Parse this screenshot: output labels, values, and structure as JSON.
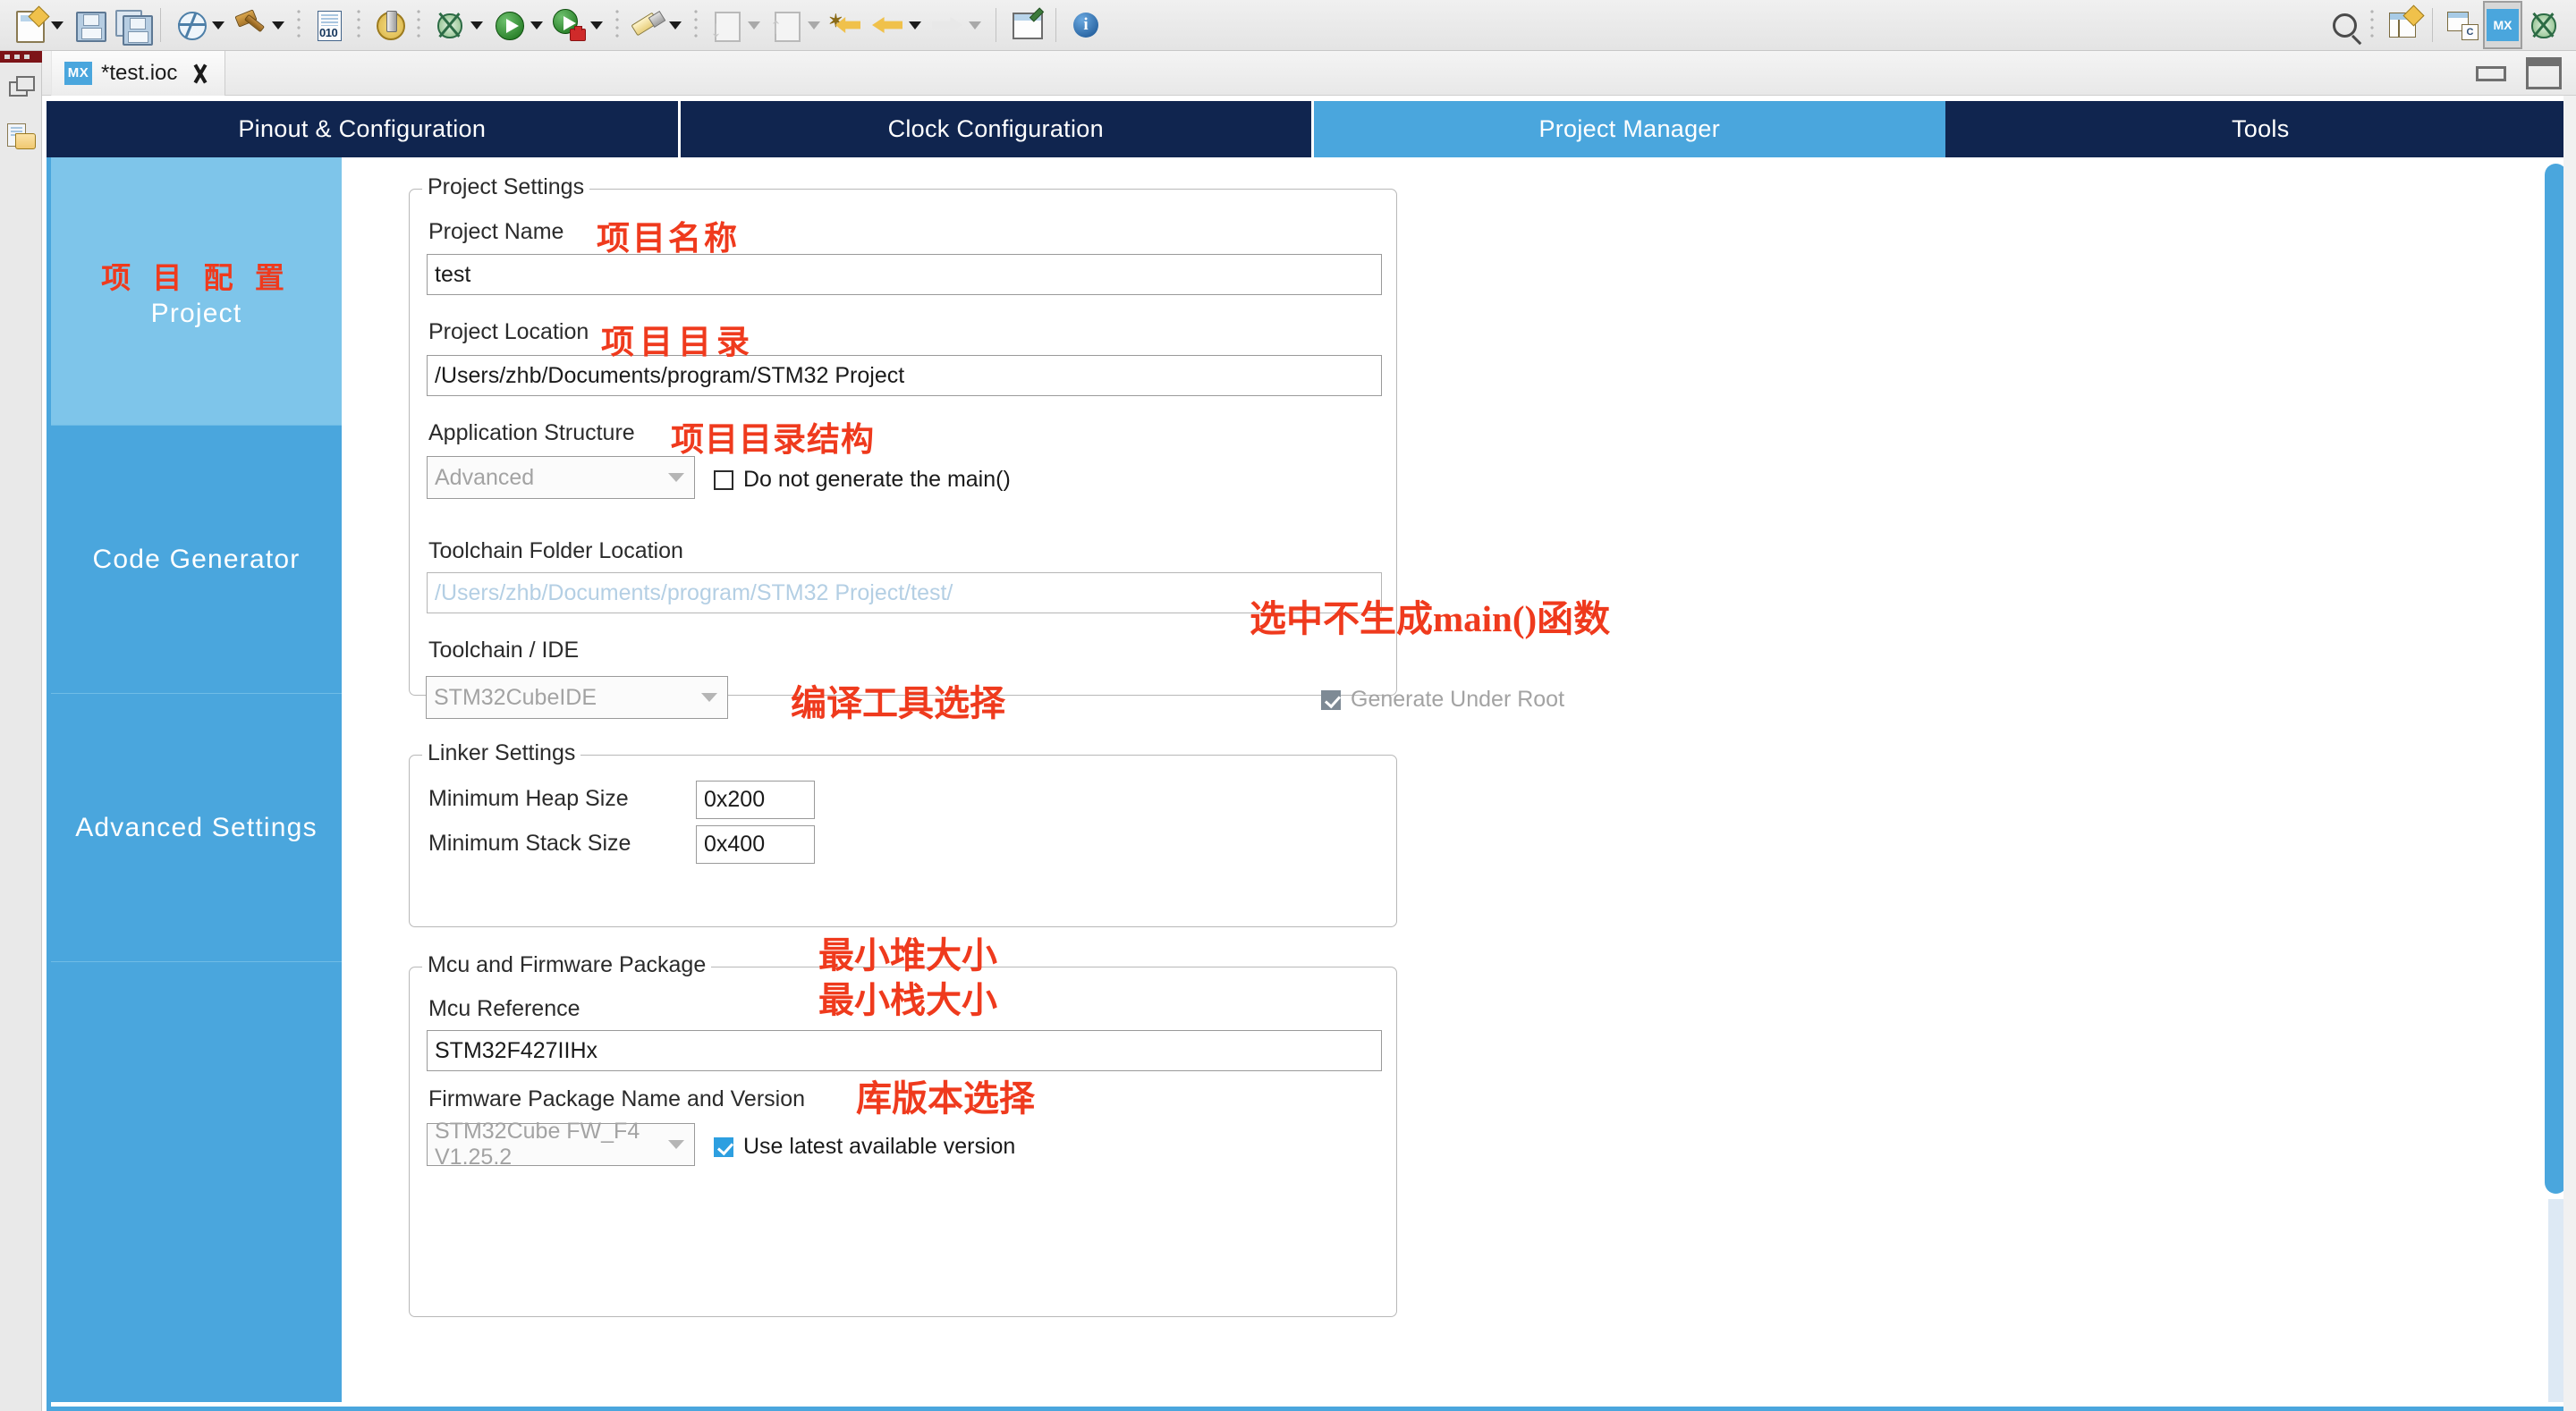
{
  "toolbar": {
    "left_icons": [
      {
        "name": "new-icon",
        "has_arrow": true
      },
      {
        "name": "save-icon",
        "has_arrow": false
      },
      {
        "name": "save-all-icon",
        "has_arrow": false
      },
      {
        "name": "skip-breakpoints-icon",
        "has_arrow": true
      },
      {
        "name": "build-hammer-icon",
        "has_arrow": true
      },
      {
        "name": "hex-editor-icon",
        "has_arrow": false
      },
      {
        "name": "build-gear-icon",
        "has_arrow": false
      },
      {
        "name": "debug-bug-icon",
        "has_arrow": true
      },
      {
        "name": "run-icon",
        "has_arrow": true
      },
      {
        "name": "run-tools-icon",
        "has_arrow": true
      },
      {
        "name": "pen-icon",
        "has_arrow": true
      },
      {
        "name": "import-icon",
        "has_arrow": true
      },
      {
        "name": "export-icon",
        "has_arrow": true
      },
      {
        "name": "back-star-icon",
        "has_arrow": false
      },
      {
        "name": "back-icon",
        "has_arrow": true
      },
      {
        "name": "forward-icon",
        "has_arrow": true
      },
      {
        "name": "pin-editor-icon",
        "has_arrow": false
      },
      {
        "name": "info-icon",
        "has_arrow": false
      }
    ],
    "right_icons": [
      {
        "name": "search-icon"
      },
      {
        "name": "open-perspective-icon"
      },
      {
        "name": "c-cpp-perspective-icon"
      },
      {
        "name": "device-configuration-perspective-icon",
        "label": "MX",
        "selected": true
      },
      {
        "name": "debug-perspective-icon"
      }
    ],
    "hex_icon_label": "010",
    "mx_perspective_label": "MX",
    "c_perspective_label": "C",
    "info_icon_label": "i"
  },
  "left_rail": {
    "icons": [
      {
        "name": "restore-view-icon"
      },
      {
        "name": "project-explorer-icon"
      }
    ]
  },
  "editor_tab": {
    "badge": "MX",
    "title": "*test.ioc",
    "close_label": "close",
    "window_minimize": "minimize",
    "window_maximize": "maximize"
  },
  "nav_tabs": [
    {
      "label": "Pinout & Configuration",
      "selected": false
    },
    {
      "label": "Clock Configuration",
      "selected": false
    },
    {
      "label": "Project Manager",
      "selected": true
    },
    {
      "label": "Tools",
      "selected": false
    }
  ],
  "sidebar": {
    "items": [
      {
        "label": "Project",
        "zh": "项 目 配 置",
        "selected": true
      },
      {
        "label": "Code Generator",
        "zh": "",
        "selected": false
      },
      {
        "label": "Advanced Settings",
        "zh": "",
        "selected": false
      },
      {
        "label": "",
        "zh": "",
        "selected": false
      }
    ]
  },
  "project_settings": {
    "group_title": "Project Settings",
    "project_name_label": "Project Name",
    "project_name_value": "test",
    "project_location_label": "Project Location",
    "project_location_value": "/Users/zhb/Documents/program/STM32 Project",
    "application_structure_label": "Application Structure",
    "application_structure_value": "Advanced",
    "do_not_generate_main_label": "Do not generate the main()",
    "do_not_generate_main_checked": false,
    "toolchain_folder_label": "Toolchain Folder Location",
    "toolchain_folder_value": "/Users/zhb/Documents/program/STM32 Project/test/",
    "toolchain_ide_label": "Toolchain / IDE",
    "toolchain_ide_value": "STM32CubeIDE",
    "generate_under_root_label": "Generate Under Root",
    "generate_under_root_checked": true
  },
  "linker_settings": {
    "group_title": "Linker Settings",
    "min_heap_label": "Minimum Heap Size",
    "min_heap_value": "0x200",
    "min_stack_label": "Minimum Stack Size",
    "min_stack_value": "0x400"
  },
  "mcu_firmware": {
    "group_title": "Mcu and Firmware Package",
    "mcu_reference_label": "Mcu Reference",
    "mcu_reference_value": "STM32F427IIHx",
    "firmware_package_label": "Firmware Package Name and Version",
    "firmware_package_value": "STM32Cube FW_F4 V1.25.2",
    "use_latest_label": "Use latest available version",
    "use_latest_checked": true
  },
  "annotations": [
    {
      "text": "项目名称",
      "note": "project name"
    },
    {
      "text": "项目目录",
      "note": "project location"
    },
    {
      "text": "项目目录结构",
      "note": "application structure"
    },
    {
      "text": "选中不生成main()函数",
      "note": "check to not generate main()"
    },
    {
      "text": "编译工具选择",
      "note": "toolchain selection"
    },
    {
      "text": "最小堆大小",
      "note": "minimum heap size"
    },
    {
      "text": "最小栈大小",
      "note": "minimum stack size"
    },
    {
      "text": "库版本选择",
      "note": "library version selection"
    }
  ],
  "colors": {
    "nav_dark": "#10254f",
    "accent_blue": "#4aa6dd",
    "sidebar_selected": "#7ec5ea",
    "annotation_red": "#ef3a1d"
  }
}
